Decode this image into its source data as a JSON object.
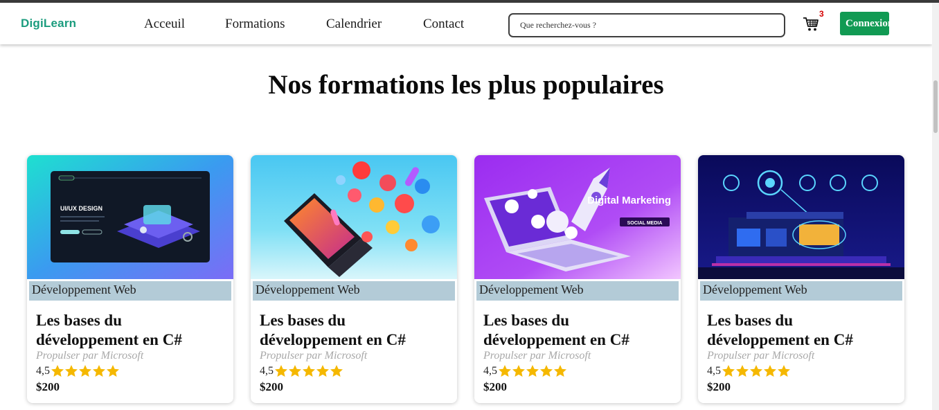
{
  "header": {
    "logo": {
      "part1": "Digi",
      "part2": "Learn"
    },
    "nav": [
      "Acceuil",
      "Formations",
      "Calendrier",
      "Contact"
    ],
    "search_placeholder": "Que recherchez-vous ?",
    "cart_count": "3",
    "login_label": "Connexion",
    "icons": {
      "cart": "cart-icon"
    },
    "colors": {
      "brand": "#1b9c7e",
      "login_bg": "#119a53",
      "badge": "#d50000"
    }
  },
  "main": {
    "title": "Nos formations les plus populaires",
    "courses": [
      {
        "image": "ui-ux-design-illustration",
        "image_text": "UI/UX DESIGN",
        "category": "Développement Web",
        "title": "Les bases du développement en C#",
        "subtitle": "Propulser par Microsoft",
        "rating": "4,5",
        "stars": 5,
        "price": "$200"
      },
      {
        "image": "social-media-laptop-illustration",
        "category": "Développement Web",
        "title": "Les bases du développement en C#",
        "subtitle": "Propulser par Microsoft",
        "rating": "4,5",
        "stars": 5,
        "price": "$200"
      },
      {
        "image": "digital-marketing-illustration",
        "image_text": "Digital Marketing",
        "image_badge": "SOCIAL MEDIA",
        "category": "Développement Web",
        "title": "Les bases du développement en C#",
        "subtitle": "Propulser par Microsoft",
        "rating": "4,5",
        "stars": 5,
        "price": "$200"
      },
      {
        "image": "smart-home-illustration",
        "category": "Développement Web",
        "title": "Les bases du développement en C#",
        "subtitle": "Propulser par Microsoft",
        "rating": "4,5",
        "stars": 5,
        "price": "$200"
      }
    ],
    "colors": {
      "category_bg": "#b3cbd7",
      "star": "#f5b800"
    }
  }
}
